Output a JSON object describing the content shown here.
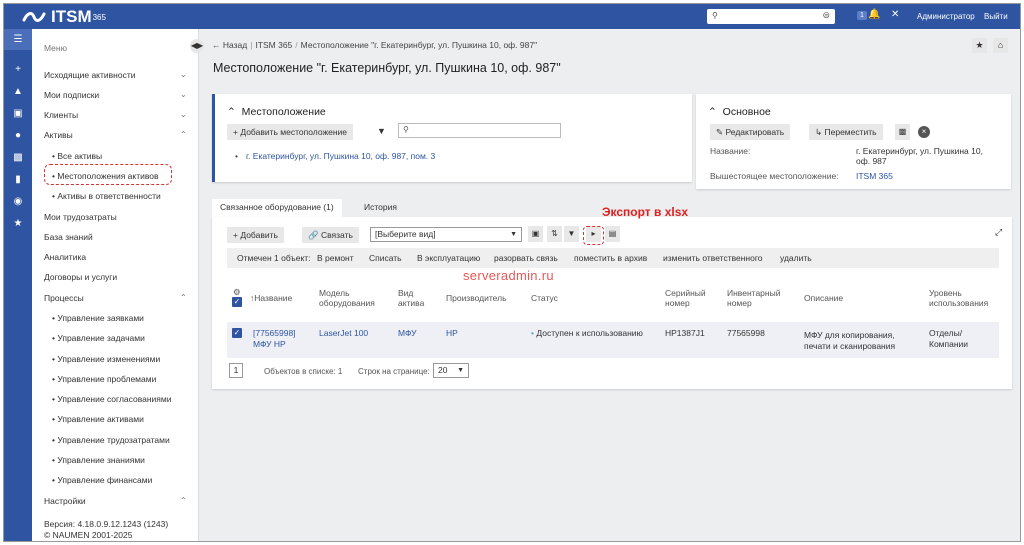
{
  "topbar": {
    "brand": "ITSM",
    "brand_version": "365",
    "search_value": "",
    "notifications_count": "1",
    "admin_label": "Администратор",
    "exit_label": "Выйти"
  },
  "sidebar_menu": {
    "header": "Меню",
    "items": [
      {
        "label": "Исходящие активности",
        "chevron": "⌄"
      },
      {
        "label": "Мои подписки",
        "chevron": "⌄"
      },
      {
        "label": "Клиенты",
        "chevron": "⌄"
      },
      {
        "label": "Активы",
        "chevron": "⌃"
      },
      {
        "label": "• Все активы"
      },
      {
        "label": "• Местоположения активов"
      },
      {
        "label": "• Активы в ответственности"
      },
      {
        "label": "Мои трудозатраты"
      },
      {
        "label": "База знаний"
      },
      {
        "label": "Аналитика"
      },
      {
        "label": "Договоры и услуги"
      },
      {
        "label": "Процессы",
        "chevron": "⌃"
      },
      {
        "label": "• Управление заявками"
      },
      {
        "label": "• Управление задачами"
      },
      {
        "label": "• Управление изменениями"
      },
      {
        "label": "• Управление проблемами"
      },
      {
        "label": "• Управление согласованиями"
      },
      {
        "label": "• Управление активами"
      },
      {
        "label": "• Управление трудозатратами"
      },
      {
        "label": "• Управление знаниями"
      },
      {
        "label": "• Управление финансами"
      },
      {
        "label": "Настройки",
        "chevron": "⌃"
      }
    ],
    "version_line1": "Версия: 4.18.0.9.12.1243 (1243)",
    "version_line2": "© NAUMEN 2001-2025"
  },
  "breadcrumb": {
    "back": "← Назад",
    "root": "ITSM 365",
    "current": "Местоположение \"г. Екатеринбург, ул. Пушкина 10, оф. 987\""
  },
  "page_title": "Местоположение \"г. Екатеринбург, ул. Пушкина 10, оф. 987\"",
  "location_card": {
    "title": "Местоположение",
    "add_button": "Добавить местоположение",
    "search_value": "",
    "items": [
      "г. Екатеринбург, ул. Пушкина 10, оф. 987, пом. 3"
    ]
  },
  "main_card": {
    "title": "Основное",
    "edit_button": "Редактировать",
    "move_button": "Переместить",
    "name_label": "Название:",
    "name_value_line1": "г. Екатеринбург, ул. Пушкина 10,",
    "name_value_line2": "оф. 987",
    "parent_label": "Вышестоящее местоположение:",
    "parent_value": "ITSM 365"
  },
  "tabs": [
    "Связанное оборудование (1)",
    "История"
  ],
  "equipment": {
    "add_button": "Добавить",
    "link_button": "Связать",
    "view_select": "[Выберите вид]",
    "export_annotation": "Экспорт в xlsx",
    "watermark": "serveradmin.ru",
    "actions": {
      "selected": "Отмечен 1 объект:",
      "repair": "В ремонт",
      "writeoff": "Списать",
      "operate": "В эксплуатацию",
      "unlink": "разорвать связь",
      "archive": "поместить в архив",
      "change_owner": "изменить ответственного",
      "delete": "удалить"
    },
    "columns": {
      "name": "Название",
      "model_1": "Модель",
      "model_2": "оборудования",
      "type_1": "Вид",
      "type_2": "актива",
      "vendor": "Производитель",
      "status": "Статус",
      "serial_1": "Серийный",
      "serial_2": "номер",
      "inventory_1": "Инвентарный",
      "inventory_2": "номер",
      "description": "Описание",
      "usage_1": "Уровень",
      "usage_2": "использования"
    },
    "rows": [
      {
        "name_1": "[77565998]",
        "name_2": "МФУ HP",
        "model": "LaserJet 100",
        "type": "МФУ",
        "vendor": "HP",
        "status": "Доступен к использованию",
        "serial": "HP1387J1",
        "inventory": "77565998",
        "desc_1": "МФУ для копирования,",
        "desc_2": "печати и сканирования",
        "usage_1": "Отделы/",
        "usage_2": "Компании"
      }
    ],
    "pager": {
      "page": "1",
      "count": "Объектов в списке: 1",
      "per_page_label": "Строк на странице:",
      "per_page_value": "20"
    }
  }
}
